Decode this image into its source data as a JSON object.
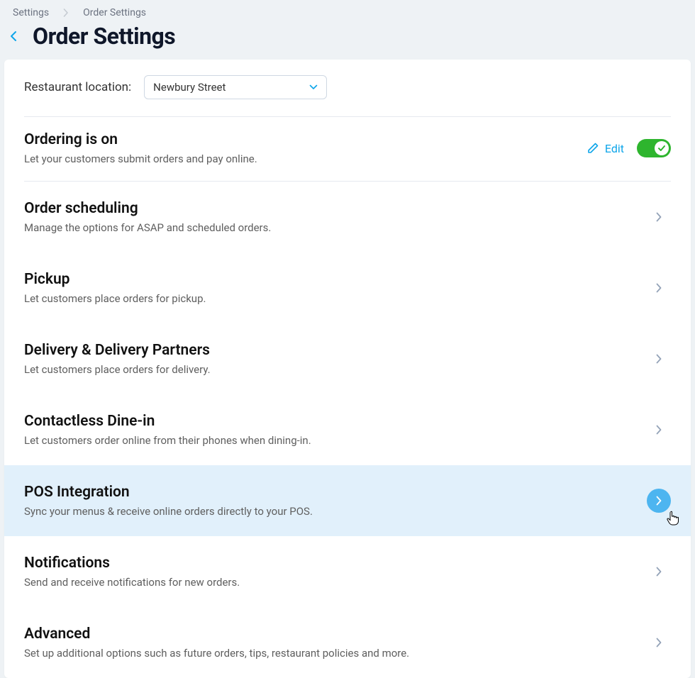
{
  "breadcrumb": {
    "root": "Settings",
    "current": "Order Settings"
  },
  "page_title": "Order Settings",
  "location": {
    "label": "Restaurant location:",
    "value": "Newbury Street"
  },
  "ordering": {
    "title": "Ordering is on",
    "desc": "Let your customers submit orders and pay online.",
    "edit": "Edit",
    "on": true
  },
  "sections": {
    "scheduling": {
      "title": "Order scheduling",
      "desc": "Manage the options for ASAP and scheduled orders."
    },
    "pickup": {
      "title": "Pickup",
      "desc": "Let customers place orders for pickup."
    },
    "delivery": {
      "title": "Delivery & Delivery Partners",
      "desc": "Let customers place orders for delivery."
    },
    "dinein": {
      "title": "Contactless Dine-in",
      "desc": "Let customers order online from their phones when dining-in."
    },
    "pos": {
      "title": "POS Integration",
      "desc": "Sync your menus & receive online orders directly to your POS."
    },
    "notifications": {
      "title": "Notifications",
      "desc": "Send and receive notifications for new orders."
    },
    "advanced": {
      "title": "Advanced",
      "desc": "Set up additional options such as future orders, tips, restaurant policies and more."
    }
  }
}
